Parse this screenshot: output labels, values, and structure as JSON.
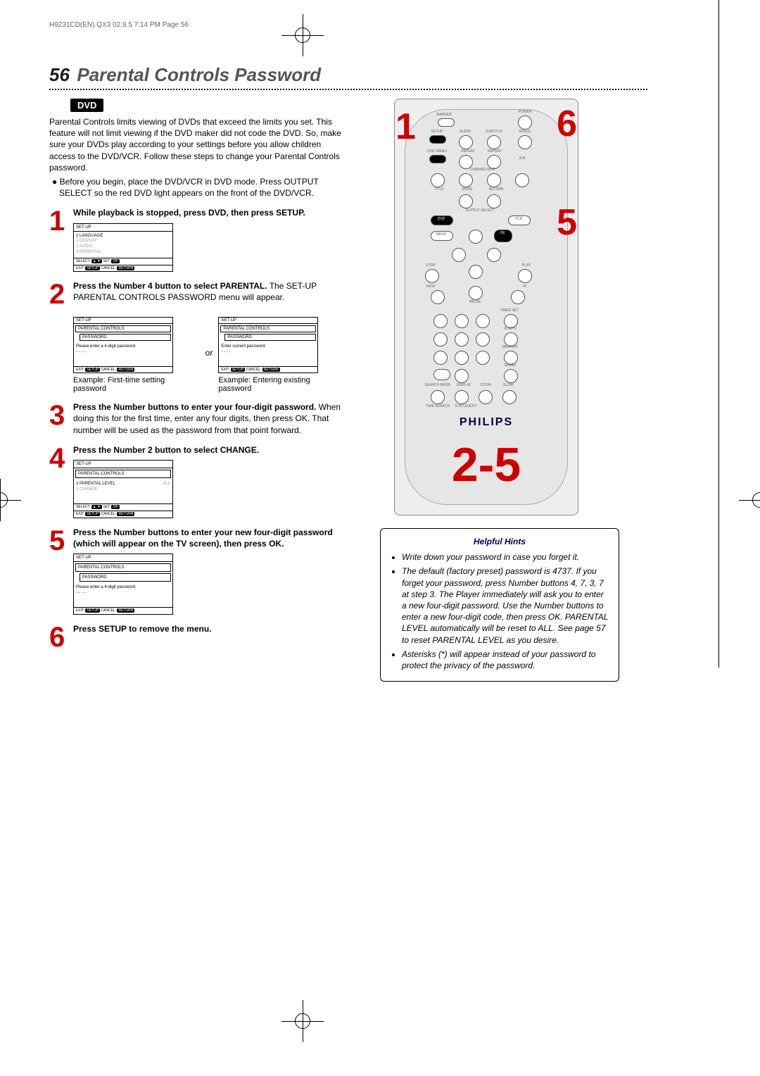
{
  "header_print": "H9231CD(EN).QX3   02.9.5 7:14 PM   Page 56",
  "page_number": "56",
  "page_title": "Parental Controls Password",
  "dvd_tag": "DVD",
  "intro": "Parental Controls limits viewing of DVDs that exceed the limits you set. This feature will not limit viewing if the DVD maker did not code the DVD. So, make sure your DVDs play according to your settings before you allow children access to the DVD/VCR. Follow these steps to change your Parental Controls password.",
  "pre_bullet": "● Before you begin, place the DVD/VCR in DVD mode. Press OUTPUT SELECT so the red DVD light appears on the front of the DVD/VCR.",
  "steps": {
    "s1": {
      "num": "1",
      "bold": "While playback is stopped, press DVD, then press SETUP."
    },
    "s2": {
      "num": "2",
      "bold": "Press the Number 4 button to select PARENTAL.",
      "rest": " The SET-UP PARENTAL CONTROLS PASSWORD menu will appear."
    },
    "s3": {
      "num": "3",
      "bold": "Press the Number buttons to enter your four-digit password.",
      "rest": " When doing this for the first time, enter any four digits, then press OK. That number will be used as the password from that point forward."
    },
    "s4": {
      "num": "4",
      "bold": "Press the Number 2 button to select CHANGE."
    },
    "s5": {
      "num": "5",
      "bold": "Press the Number buttons to enter your new four-digit password (which will appear on the TV screen), then press OK."
    },
    "s6": {
      "num": "6",
      "bold": "Press SETUP to remove the menu."
    }
  },
  "screen1": {
    "title": "SET-UP",
    "l1": "1 LANGUAGE",
    "l2": "2 DISPLAY",
    "l3": "3 AUDIO",
    "l4": "4 PARENTAL",
    "foot_l": "SELECT:",
    "foot_btn1": "▲ ▼",
    "foot_m": "SET:",
    "foot_btn2": "OK",
    "foot_r": "EXIT:",
    "foot_btn3": "SETUP",
    "foot_c": "CANCEL:",
    "foot_btn4": "RETURN"
  },
  "screen2a": {
    "title": "SET-UP",
    "sub1": "PARENTAL CONTROLS",
    "sub2": "PASSWORD",
    "body": "Please enter a 4-digit password.",
    "dots": "- - - -",
    "ex": "EXIT:",
    "b1": "SETUP",
    "cn": "CANCEL:",
    "b2": "RETURN"
  },
  "screen2b": {
    "title": "SET-UP",
    "sub1": "PARENTAL CONTROLS",
    "sub2": "PASSWORD",
    "body": "Enter current password.",
    "dots": "- - - -",
    "ex": "EXIT:",
    "b1": "SETUP",
    "cn": "CANCEL:",
    "b2": "RETURN"
  },
  "or": "or",
  "caption_a": "Example: First-time setting password",
  "caption_b": "Example: Entering existing password",
  "screen4": {
    "title": "SET-UP",
    "sub": "PARENTAL CONTROLS",
    "l1": "1 PARENTAL LEVEL",
    "v1": "ALL",
    "l2": "2 CHANGE",
    "sl": "SELECT:",
    "b1": "▲ ▼",
    "st": "SET:",
    "b2": "OK",
    "ex": "EXIT:",
    "b3": "SETUP",
    "cn": "CANCEL:",
    "b4": "RETURN"
  },
  "screen5": {
    "title": "SET-UP",
    "sub1": "PARENTAL CONTROLS",
    "sub2": "PASSWORD",
    "body": "Please enter a 4-digit password.",
    "dots": "- - - -",
    "ex": "EXIT:",
    "b1": "SETUP",
    "cn": "CANCEL:",
    "b2": "RETURN"
  },
  "remote": {
    "c1": "1",
    "c6": "6",
    "c5": "5",
    "c25": "2-5",
    "brand": "PHILIPS",
    "lbls": {
      "marker": "MARKER",
      "power": "POWER",
      "setup": "SETUP",
      "audio": "AUDIO",
      "subtitle": "SUBTITLE",
      "angle": "ANGLE",
      "discmenu": "DISC MENU",
      "repeat": "REPEAT",
      "repeat2": "REPEAT",
      "ab": "A-B",
      "chskip": "CHANNEL/SKIP",
      "title": "TITLE",
      "mode": "MODE",
      "return": "RETURN",
      "output": "OUTPUT SELECT",
      "dvd": "DVD",
      "vcr": "VCR",
      "menu": "MENU",
      "ok": "OK",
      "stop": "STOP",
      "play": "PLAY",
      "rew": "REW",
      "ff": "FF",
      "pause": "PAUSE",
      "timer": "TIMER SET",
      "vcrtv": "VCR/TV",
      "memory": "MEMORY",
      "speed": "SPEED",
      "search": "SEARCH MODE",
      "display": "DISPLAY",
      "zoom": "ZOOM",
      "slow": "SLOW",
      "timesearch": "TIME SEARCH",
      "status": "STATUS/EXIT"
    }
  },
  "hints_title": "Helpful Hints",
  "hints": {
    "h1": "Write down your password in case you forget it.",
    "h2": "The default (factory preset) password is 4737. If you forget your password, press Number buttons 4, 7, 3, 7 at step 3. The Player immediately will ask you to enter a new four-digit password. Use the Number buttons to enter a new four-digit code, then press OK. PARENTAL LEVEL automatically will be reset to ALL. See page 57 to reset PARENTAL LEVEL as you desire.",
    "h3": "Asterisks (*) will appear instead of your password to protect the privacy of the password."
  }
}
